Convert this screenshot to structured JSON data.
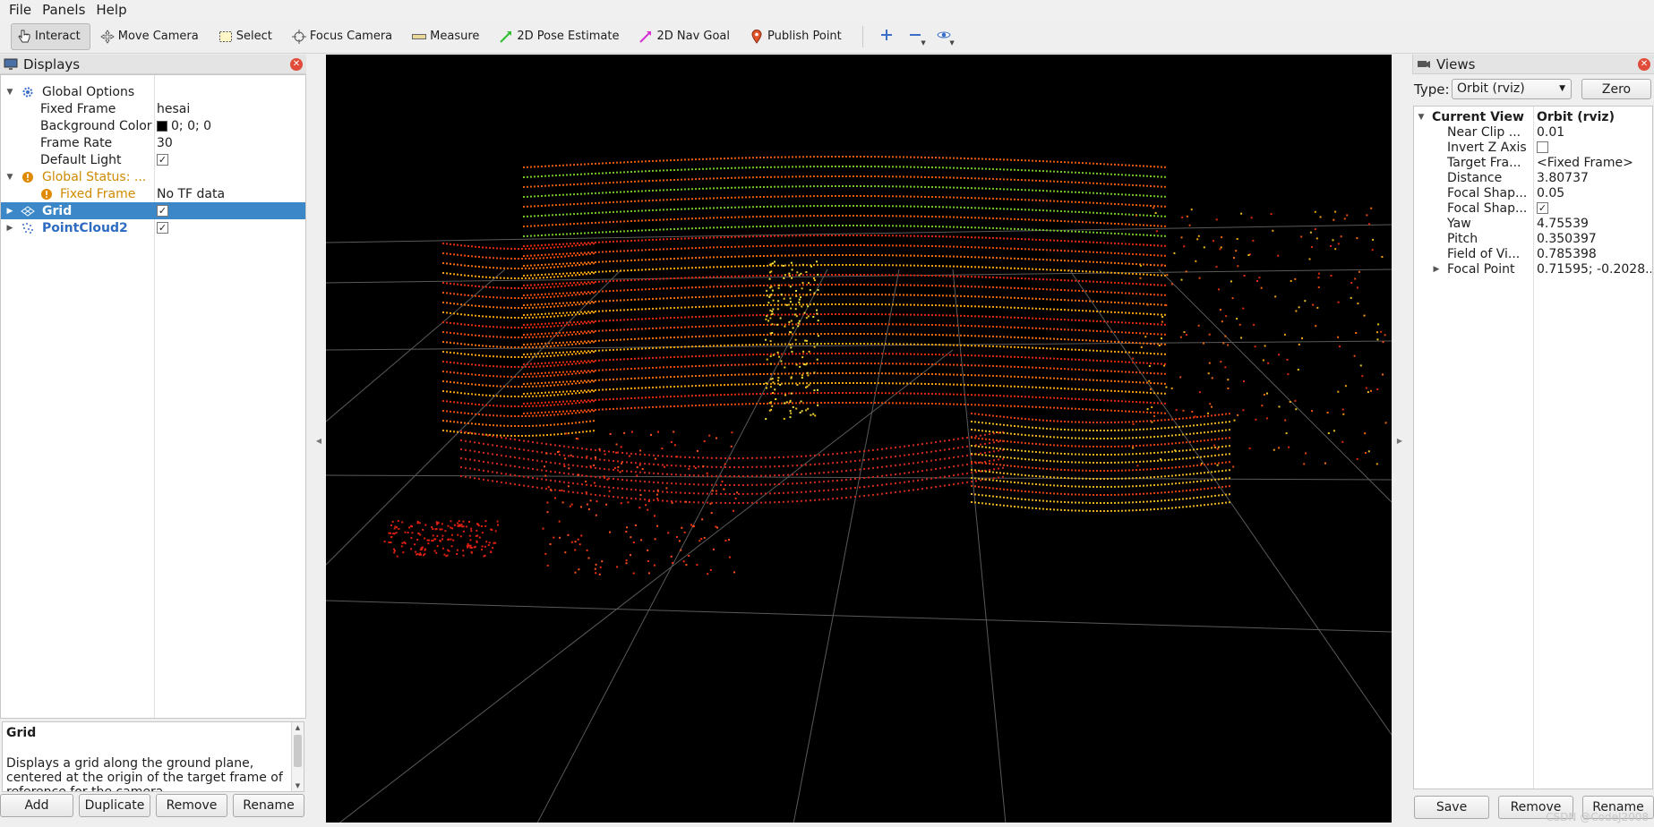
{
  "menubar": {
    "items": [
      {
        "label": "File"
      },
      {
        "label": "Panels"
      },
      {
        "label": "Help"
      }
    ]
  },
  "toolbar": {
    "tools": [
      {
        "label": "Interact",
        "icon": "hand-cursor-icon"
      },
      {
        "label": "Move Camera",
        "icon": "move-camera-icon"
      },
      {
        "label": "Select",
        "icon": "select-box-icon"
      },
      {
        "label": "Focus Camera",
        "icon": "focus-crosshair-icon"
      },
      {
        "label": "Measure",
        "icon": "ruler-icon"
      },
      {
        "label": "2D Pose Estimate",
        "icon": "green-arrow-icon"
      },
      {
        "label": "2D Nav Goal",
        "icon": "magenta-arrow-icon"
      },
      {
        "label": "Publish Point",
        "icon": "map-pin-icon"
      }
    ],
    "active": "Interact"
  },
  "displays": {
    "title": "Displays",
    "rows": [
      {
        "label": "Global Options",
        "value": ""
      },
      {
        "label": "Fixed Frame",
        "value": "hesai"
      },
      {
        "label": "Background Color",
        "value": "0; 0; 0"
      },
      {
        "label": "Frame Rate",
        "value": "30"
      },
      {
        "label": "Default Light",
        "value": "✓"
      },
      {
        "label": "Global Status: ...",
        "value": ""
      },
      {
        "label": "Fixed Frame",
        "value": "No TF data"
      },
      {
        "label": "Grid",
        "value": "✓"
      },
      {
        "label": "PointCloud2",
        "value": "✓"
      }
    ],
    "description": {
      "title": "Grid",
      "text": "Displays a grid along the ground plane, centered at the origin of the target frame of reference for the camera."
    },
    "buttons": {
      "add": "Add",
      "duplicate": "Duplicate",
      "remove": "Remove",
      "rename": "Rename"
    }
  },
  "views": {
    "title": "Views",
    "type_label": "Type:",
    "type_value": "Orbit (rviz)",
    "zero_label": "Zero",
    "rows": [
      {
        "label": "Current View",
        "value": "Orbit (rviz)"
      },
      {
        "label": "Near Clip ...",
        "value": "0.01"
      },
      {
        "label": "Invert Z Axis",
        "value": ""
      },
      {
        "label": "Target Fra...",
        "value": "<Fixed Frame>"
      },
      {
        "label": "Distance",
        "value": "3.80737"
      },
      {
        "label": "Focal Shap...",
        "value": "0.05"
      },
      {
        "label": "Focal Shap...",
        "value": "✓"
      },
      {
        "label": "Yaw",
        "value": "4.75539"
      },
      {
        "label": "Pitch",
        "value": "0.350397"
      },
      {
        "label": "Field of Vi...",
        "value": "0.785398"
      },
      {
        "label": "Focal Point",
        "value": "0.71595; -0.2028..."
      }
    ],
    "buttons": {
      "save": "Save",
      "remove": "Remove",
      "rename": "Rename"
    }
  },
  "colors": {
    "selection": "#3b87c8",
    "warning": "#d08a00",
    "view_background": "#000000"
  },
  "watermark": "CSDN @CodeJ2008"
}
